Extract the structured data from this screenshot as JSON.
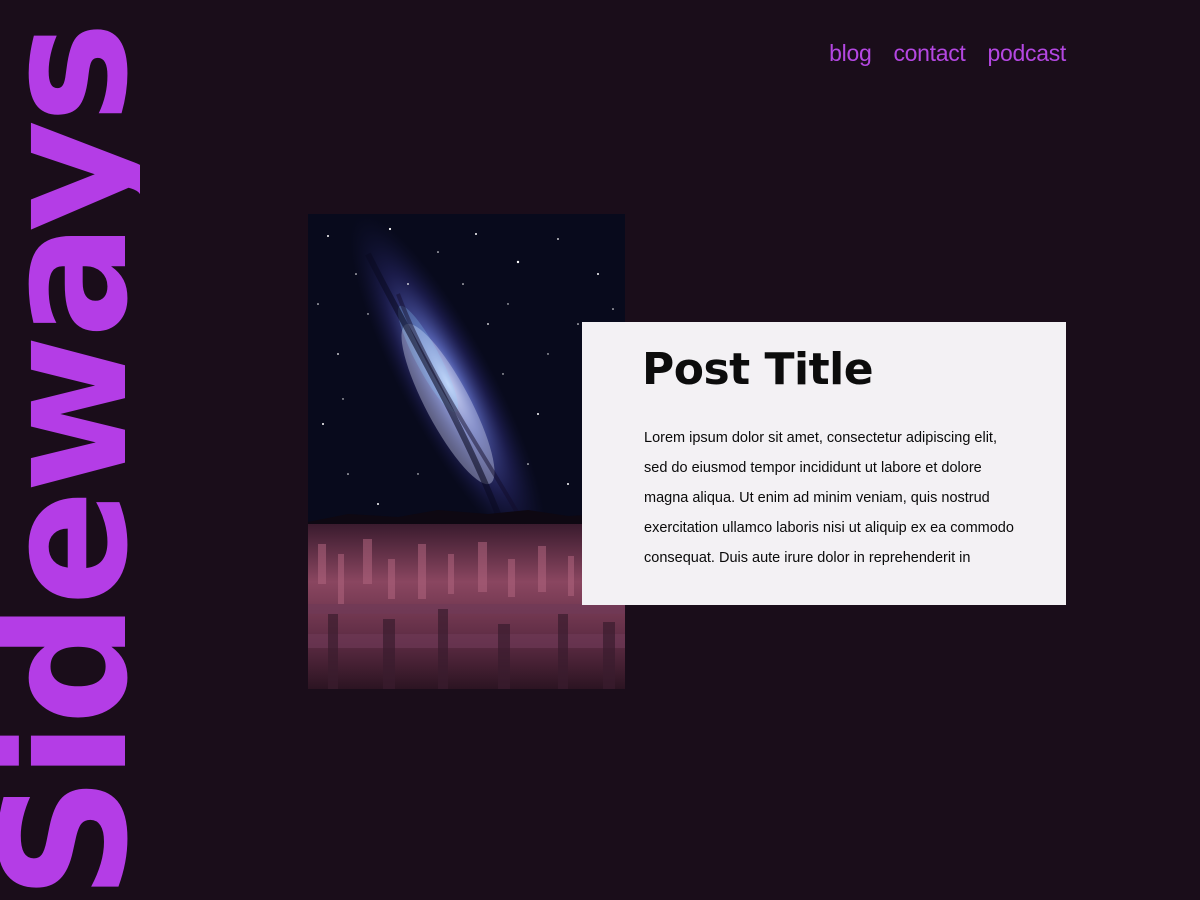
{
  "brand": {
    "name": "Sideways"
  },
  "nav": {
    "items": [
      {
        "label": "blog"
      },
      {
        "label": "contact"
      },
      {
        "label": "podcast"
      }
    ]
  },
  "post": {
    "title": "Post Title",
    "excerpt": "Lorem ipsum dolor sit amet, consectetur adipiscing elit, sed do eiusmod tempor incididunt ut labore et dolore magna aliqua. Ut enim ad minim veniam, quis nostrud exercitation ullamco laboris nisi ut aliquip ex ea commodo consequat. Duis aute irure dolor in reprehenderit in"
  },
  "colors": {
    "background": "#1a0d1a",
    "accent": "#b43de6",
    "card": "#f3f1f4"
  }
}
